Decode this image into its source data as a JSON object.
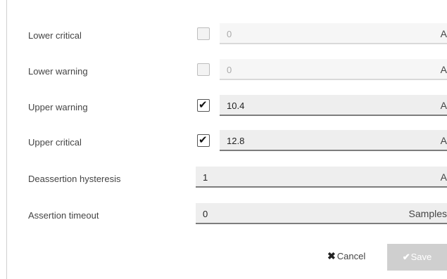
{
  "rows": [
    {
      "label": "Lower critical",
      "checked": false,
      "value": "0",
      "unit": "A",
      "enabled": false
    },
    {
      "label": "Lower warning",
      "checked": false,
      "value": "0",
      "unit": "A",
      "enabled": false
    },
    {
      "label": "Upper warning",
      "checked": true,
      "value": "10.4",
      "unit": "A",
      "enabled": true
    },
    {
      "label": "Upper critical",
      "checked": true,
      "value": "12.8",
      "unit": "A",
      "enabled": true
    },
    {
      "label": "Deassertion hysteresis",
      "value": "1",
      "unit": "A",
      "enabled": true
    },
    {
      "label": "Assertion timeout",
      "value": "0",
      "unit": "Samples",
      "enabled": true
    }
  ],
  "actions": {
    "cancel": "Cancel",
    "save": "Save"
  },
  "icons": {
    "cancel": "close-icon",
    "save": "checkmark-icon"
  }
}
